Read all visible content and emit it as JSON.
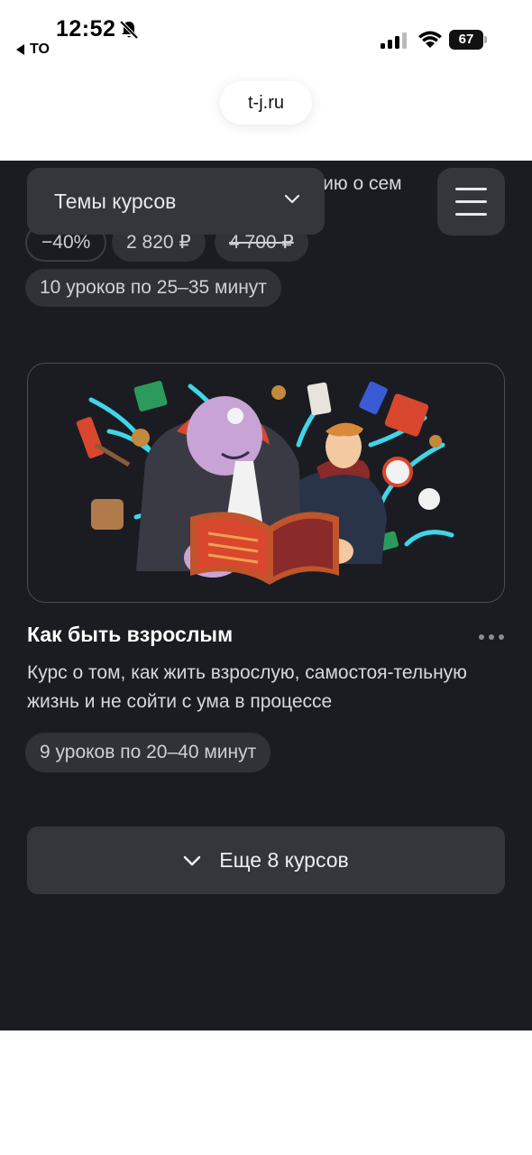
{
  "status_bar": {
    "time": "12:52",
    "back_app": "TO",
    "battery": "67"
  },
  "browser": {
    "url": "t-j.ru"
  },
  "header": {
    "topics_label": "Темы курсов"
  },
  "previous_course": {
    "description_fragment": "мацию о сем",
    "discount": "−40%",
    "price": "2 820 ₽",
    "old_price": "4 700 ₽",
    "lessons": "10 уроков по 25–35 минут"
  },
  "course": {
    "title": "Как быть взрослым",
    "description": "Курс о том, как жить взрослую, самостоя-тельную жизнь и не сойти с ума в процессе",
    "lessons": "9 уроков по 20–40 минут"
  },
  "more_courses": {
    "label": "Еще 8 курсов"
  },
  "colors": {
    "page_background": "#1a1c22",
    "surface": "#34363c",
    "chip": "#303238",
    "accent_cyan": "#3fd6e8"
  }
}
